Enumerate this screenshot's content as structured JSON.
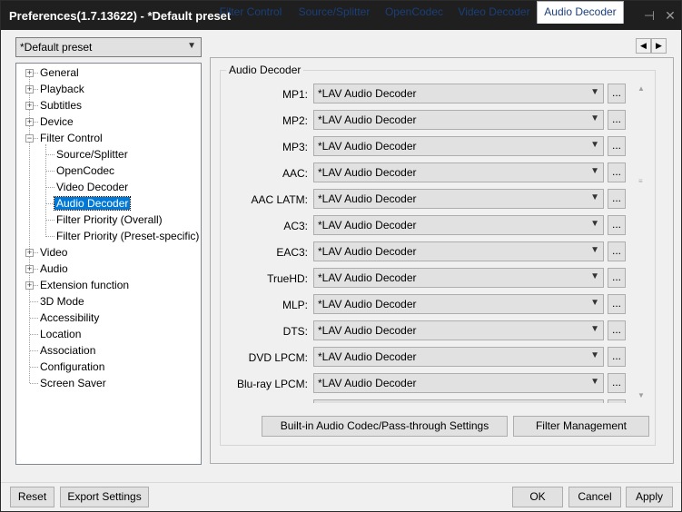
{
  "window": {
    "title": "Preferences(1.7.13622) - *Default preset",
    "pin_glyph": "⊣",
    "close_glyph": "✕"
  },
  "preset": {
    "selected": "*Default preset"
  },
  "tree": {
    "items": [
      {
        "label": "General",
        "level": 0,
        "expander": "+"
      },
      {
        "label": "Playback",
        "level": 0,
        "expander": "+"
      },
      {
        "label": "Subtitles",
        "level": 0,
        "expander": "+"
      },
      {
        "label": "Device",
        "level": 0,
        "expander": "+"
      },
      {
        "label": "Filter Control",
        "level": 0,
        "expander": "−"
      },
      {
        "label": "Source/Splitter",
        "level": 1
      },
      {
        "label": "OpenCodec",
        "level": 1
      },
      {
        "label": "Video Decoder",
        "level": 1
      },
      {
        "label": "Audio Decoder",
        "level": 1,
        "selected": true
      },
      {
        "label": "Filter Priority (Overall)",
        "level": 1
      },
      {
        "label": "Filter Priority (Preset-specific)",
        "level": 1
      },
      {
        "label": "Video",
        "level": 0,
        "expander": "+"
      },
      {
        "label": "Audio",
        "level": 0,
        "expander": "+"
      },
      {
        "label": "Extension function",
        "level": 0,
        "expander": "+"
      },
      {
        "label": "3D Mode",
        "level": 0
      },
      {
        "label": "Accessibility",
        "level": 0
      },
      {
        "label": "Location",
        "level": 0
      },
      {
        "label": "Association",
        "level": 0
      },
      {
        "label": "Configuration",
        "level": 0
      },
      {
        "label": "Screen Saver",
        "level": 0
      }
    ]
  },
  "tabs": {
    "items": [
      "Filter Control",
      "Source/Splitter",
      "OpenCodec",
      "Video Decoder",
      "Audio Decoder"
    ],
    "active": "Audio Decoder",
    "prev_glyph": "◀",
    "next_glyph": "▶"
  },
  "audio_decoder": {
    "group_title": "Audio Decoder",
    "rows": [
      {
        "label": "MP1:",
        "value": "*LAV Audio Decoder"
      },
      {
        "label": "MP2:",
        "value": "*LAV Audio Decoder"
      },
      {
        "label": "MP3:",
        "value": "*LAV Audio Decoder"
      },
      {
        "label": "AAC:",
        "value": "*LAV Audio Decoder"
      },
      {
        "label": "AAC LATM:",
        "value": "*LAV Audio Decoder"
      },
      {
        "label": "AC3:",
        "value": "*LAV Audio Decoder"
      },
      {
        "label": "EAC3:",
        "value": "*LAV Audio Decoder"
      },
      {
        "label": "TrueHD:",
        "value": "*LAV Audio Decoder"
      },
      {
        "label": "MLP:",
        "value": "*LAV Audio Decoder"
      },
      {
        "label": "DTS:",
        "value": "*LAV Audio Decoder"
      },
      {
        "label": "DVD LPCM:",
        "value": "*LAV Audio Decoder"
      },
      {
        "label": "Blu-ray LPCM:",
        "value": "*LAV Audio Decoder"
      }
    ],
    "more_label": "...",
    "builtin_button": "Built-in Audio Codec/Pass-through Settings",
    "filter_mgmt_button": "Filter Management"
  },
  "footer": {
    "reset": "Reset",
    "export": "Export Settings",
    "ok": "OK",
    "cancel": "Cancel",
    "apply": "Apply"
  }
}
